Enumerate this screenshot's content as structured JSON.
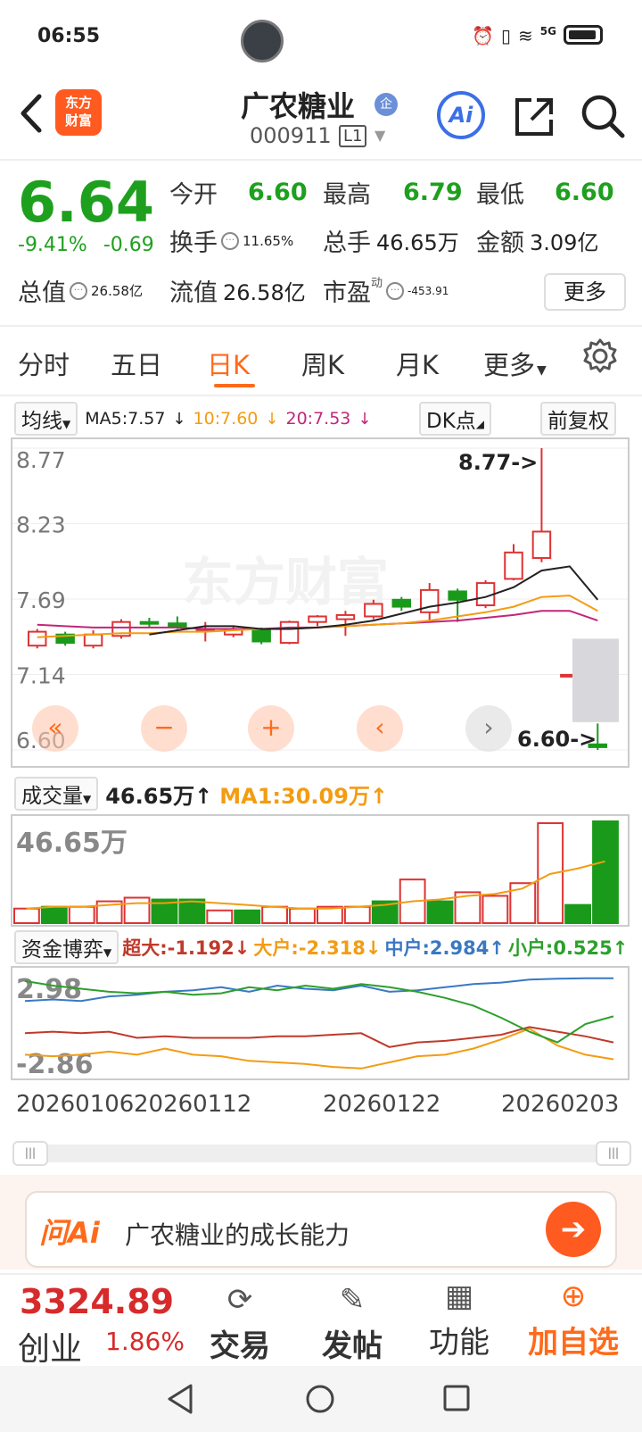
{
  "status_bar": {
    "time": "06:55",
    "network": "5G"
  },
  "header": {
    "stock_name": "广农糖业",
    "badge": "企",
    "stock_code": "000911",
    "level": "L1",
    "logo_text_1": "东方",
    "logo_text_2": "财富",
    "ai_label": "Ai"
  },
  "quote": {
    "price": "6.64",
    "change_pct": "-9.41%",
    "change_amt": "-0.69",
    "open_label": "今开",
    "open": "6.60",
    "high_label": "最高",
    "high": "6.79",
    "low_label": "最低",
    "low": "6.60",
    "turnover_label": "换手",
    "turnover": "11.65%",
    "volume_label": "总手",
    "volume": "46.65万",
    "amount_label": "金额",
    "amount": "3.09亿",
    "mktcap_label": "总值",
    "mktcap": "26.58亿",
    "float_label": "流值",
    "float_cap": "26.58亿",
    "pe_label": "市盈",
    "pe_sup": "动",
    "pe": "-453.91",
    "more": "更多"
  },
  "tabs": [
    "分时",
    "五日",
    "日K",
    "周K",
    "月K",
    "更多"
  ],
  "active_tab": "日K",
  "chart_toolbar": {
    "ma_select": "均线",
    "ma5": "MA5:7.57",
    "ma10": "10:7.60",
    "ma20": "20:7.53",
    "dk": "DK点",
    "adjust": "前复权"
  },
  "kline": {
    "y_labels": [
      "8.77",
      "8.23",
      "7.69",
      "7.14",
      "6.60"
    ],
    "high_mark": "8.77->",
    "low_mark": "6.60->",
    "watermark": "东方财富",
    "ylim": [
      6.6,
      8.77
    ],
    "candles": [
      {
        "o": 7.35,
        "c": 7.45,
        "h": 7.47,
        "l": 7.33
      },
      {
        "o": 7.43,
        "c": 7.37,
        "h": 7.45,
        "l": 7.35
      },
      {
        "o": 7.35,
        "c": 7.43,
        "h": 7.46,
        "l": 7.33
      },
      {
        "o": 7.42,
        "c": 7.52,
        "h": 7.54,
        "l": 7.4
      },
      {
        "o": 7.52,
        "c": 7.51,
        "h": 7.55,
        "l": 7.48
      },
      {
        "o": 7.51,
        "c": 7.49,
        "h": 7.56,
        "l": 7.47
      },
      {
        "o": 7.47,
        "c": 7.47,
        "h": 7.52,
        "l": 7.38
      },
      {
        "o": 7.43,
        "c": 7.47,
        "h": 7.49,
        "l": 7.41
      },
      {
        "o": 7.47,
        "c": 7.38,
        "h": 7.48,
        "l": 7.36
      },
      {
        "o": 7.37,
        "c": 7.52,
        "h": 7.53,
        "l": 7.36
      },
      {
        "o": 7.52,
        "c": 7.56,
        "h": 7.57,
        "l": 7.49
      },
      {
        "o": 7.54,
        "c": 7.57,
        "h": 7.6,
        "l": 7.42
      },
      {
        "o": 7.56,
        "c": 7.65,
        "h": 7.68,
        "l": 7.54
      },
      {
        "o": 7.68,
        "c": 7.63,
        "h": 7.7,
        "l": 7.6
      },
      {
        "o": 7.59,
        "c": 7.75,
        "h": 7.8,
        "l": 7.52
      },
      {
        "o": 7.74,
        "c": 7.68,
        "h": 7.76,
        "l": 7.52
      },
      {
        "o": 7.64,
        "c": 7.8,
        "h": 7.82,
        "l": 7.62
      },
      {
        "o": 7.83,
        "c": 8.02,
        "h": 8.08,
        "l": 7.82
      },
      {
        "o": 7.98,
        "c": 8.17,
        "h": 8.77,
        "l": 7.95
      },
      {
        "o": 7.14,
        "c": 7.14,
        "h": 7.14,
        "l": 7.14
      },
      {
        "o": 6.64,
        "c": 6.62,
        "h": 6.79,
        "l": 6.6
      }
    ],
    "ma5": [
      null,
      null,
      null,
      null,
      7.43,
      7.46,
      7.49,
      7.49,
      7.47,
      7.47,
      7.48,
      7.5,
      7.53,
      7.58,
      7.63,
      7.66,
      7.7,
      7.77,
      7.89,
      7.92,
      7.68
    ],
    "ma10": [
      7.41,
      7.42,
      7.43,
      7.44,
      7.44,
      7.45,
      7.45,
      7.46,
      7.47,
      7.47,
      7.48,
      7.49,
      7.5,
      7.51,
      7.53,
      7.56,
      7.59,
      7.63,
      7.7,
      7.71,
      7.6
    ],
    "ma20": [
      7.5,
      7.49,
      7.48,
      7.48,
      7.48,
      7.48,
      7.47,
      7.47,
      7.47,
      7.48,
      7.48,
      7.49,
      7.5,
      7.51,
      7.52,
      7.53,
      7.55,
      7.57,
      7.6,
      7.6,
      7.53
    ]
  },
  "volume": {
    "select": "成交量",
    "value": "46.65万↑",
    "ma1": "MA1:30.09万↑",
    "y_label": "46.65万",
    "bars": [
      8,
      9,
      9,
      12,
      14,
      13,
      13,
      7,
      7,
      9,
      8,
      9,
      9,
      12,
      24,
      12,
      17,
      15,
      22,
      55,
      10,
      56
    ],
    "up": [
      1,
      0,
      1,
      1,
      1,
      0,
      0,
      1,
      0,
      1,
      1,
      1,
      1,
      0,
      1,
      0,
      1,
      1,
      1,
      1,
      0,
      0
    ],
    "ma": [
      8,
      9,
      9,
      10,
      11,
      11,
      12,
      11,
      10,
      9,
      8,
      8,
      9,
      10,
      12,
      13,
      15,
      16,
      19,
      27,
      30,
      34
    ]
  },
  "funds": {
    "select": "资金博弈",
    "super_large": "超大:-1.192↓",
    "large": "大户:-2.318↓",
    "medium": "中户:2.984↑",
    "small": "小户:0.525↑",
    "y_top": "2.98",
    "y_bottom": "-2.86",
    "ylim": [
      -3.2,
      3.2
    ],
    "series": [
      {
        "key": "super",
        "color": "#c0392b",
        "values": [
          -0.6,
          -0.5,
          -0.6,
          -0.5,
          -0.9,
          -0.8,
          -0.9,
          -0.9,
          -0.9,
          -0.8,
          -0.8,
          -0.7,
          -0.6,
          -1.5,
          -1.2,
          -1.1,
          -0.9,
          -0.7,
          -0.2,
          -0.5,
          -0.8,
          -1.2
        ]
      },
      {
        "key": "large",
        "color": "#f39c12",
        "values": [
          -2.0,
          -2.1,
          -2.0,
          -1.8,
          -2.0,
          -1.6,
          -2.0,
          -2.1,
          -2.4,
          -2.5,
          -2.6,
          -2.8,
          -2.9,
          -2.5,
          -2.1,
          -2.0,
          -1.6,
          -1.0,
          -0.3,
          -1.4,
          -2.0,
          -2.3
        ]
      },
      {
        "key": "medium",
        "color": "#3a78c3",
        "values": [
          1.5,
          1.6,
          1.5,
          1.8,
          1.9,
          2.1,
          2.2,
          2.4,
          2.1,
          2.5,
          2.3,
          2.2,
          2.5,
          2.1,
          2.2,
          2.4,
          2.6,
          2.7,
          2.9,
          2.95,
          2.98,
          2.98
        ]
      },
      {
        "key": "small",
        "color": "#2ca02c",
        "values": [
          2.8,
          2.5,
          2.3,
          2.1,
          2.0,
          2.1,
          1.9,
          2.0,
          2.4,
          2.2,
          2.5,
          2.3,
          2.6,
          2.4,
          2.1,
          1.7,
          1.2,
          0.4,
          -0.5,
          -1.2,
          0.0,
          0.5
        ]
      }
    ]
  },
  "x_labels": [
    "20260106",
    "20260112",
    "20260122",
    "20260203"
  ],
  "ask_ai": {
    "logo": "问Ai",
    "text": "广农糖业的成长能力"
  },
  "bottom_bar": {
    "index_value": "3324.89",
    "index_name": "创业",
    "index_pct": "1.86%",
    "trade": "交易",
    "post": "发帖",
    "features": "功能",
    "add": "加自选"
  }
}
